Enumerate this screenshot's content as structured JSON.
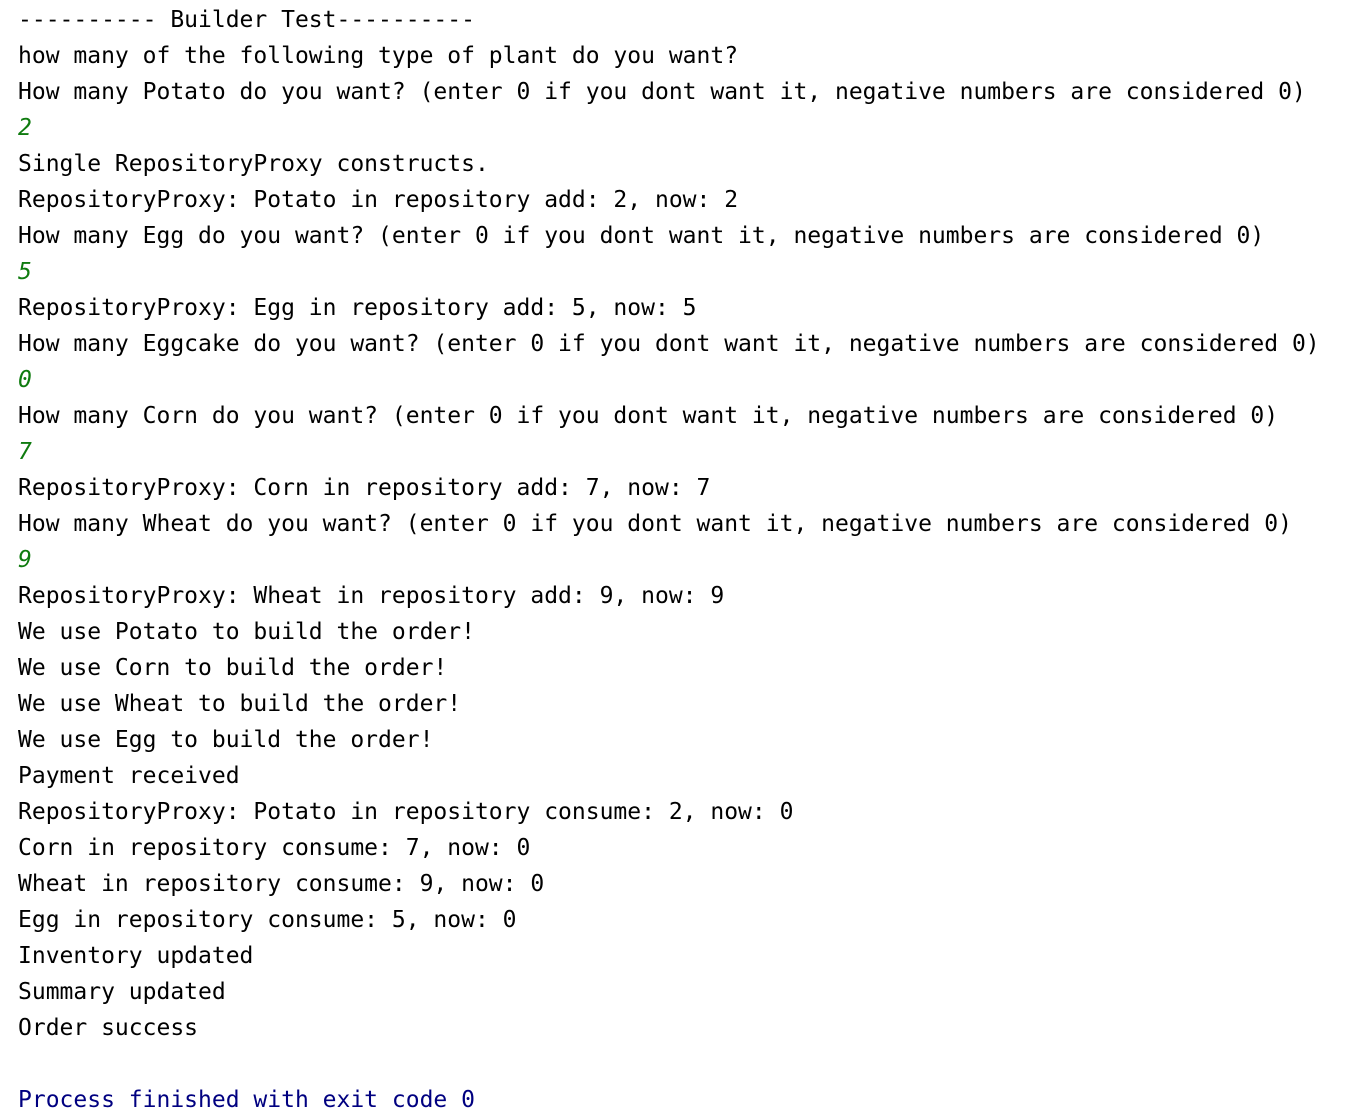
{
  "console": {
    "lines": [
      {
        "text": "---------- Builder Test----------",
        "kind": "output"
      },
      {
        "text": "how many of the following type of plant do you want?",
        "kind": "output"
      },
      {
        "text": "How many Potato do you want? (enter 0 if you dont want it, negative numbers are considered 0)",
        "kind": "output"
      },
      {
        "text": "2",
        "kind": "input"
      },
      {
        "text": "Single RepositoryProxy constructs.",
        "kind": "output"
      },
      {
        "text": "RepositoryProxy: Potato in repository add: 2, now: 2",
        "kind": "output"
      },
      {
        "text": "How many Egg do you want? (enter 0 if you dont want it, negative numbers are considered 0)",
        "kind": "output"
      },
      {
        "text": "5",
        "kind": "input"
      },
      {
        "text": "RepositoryProxy: Egg in repository add: 5, now: 5",
        "kind": "output"
      },
      {
        "text": "How many Eggcake do you want? (enter 0 if you dont want it, negative numbers are considered 0)",
        "kind": "output"
      },
      {
        "text": "0",
        "kind": "input"
      },
      {
        "text": "How many Corn do you want? (enter 0 if you dont want it, negative numbers are considered 0)",
        "kind": "output"
      },
      {
        "text": "7",
        "kind": "input"
      },
      {
        "text": "RepositoryProxy: Corn in repository add: 7, now: 7",
        "kind": "output"
      },
      {
        "text": "How many Wheat do you want? (enter 0 if you dont want it, negative numbers are considered 0)",
        "kind": "output"
      },
      {
        "text": "9",
        "kind": "input"
      },
      {
        "text": "RepositoryProxy: Wheat in repository add: 9, now: 9",
        "kind": "output"
      },
      {
        "text": "We use Potato to build the order!",
        "kind": "output"
      },
      {
        "text": "We use Corn to build the order!",
        "kind": "output"
      },
      {
        "text": "We use Wheat to build the order!",
        "kind": "output"
      },
      {
        "text": "We use Egg to build the order!",
        "kind": "output"
      },
      {
        "text": "Payment received",
        "kind": "output"
      },
      {
        "text": "RepositoryProxy: Potato in repository consume: 2, now: 0",
        "kind": "output"
      },
      {
        "text": "Corn in repository consume: 7, now: 0",
        "kind": "output"
      },
      {
        "text": "Wheat in repository consume: 9, now: 0",
        "kind": "output"
      },
      {
        "text": "Egg in repository consume: 5, now: 0",
        "kind": "output"
      },
      {
        "text": "Inventory updated",
        "kind": "output"
      },
      {
        "text": "Summary updated",
        "kind": "output"
      },
      {
        "text": "Order success",
        "kind": "output"
      },
      {
        "text": "",
        "kind": "blank"
      },
      {
        "text": "Process finished with exit code 0",
        "kind": "system"
      }
    ]
  },
  "colors": {
    "output_text": "#000000",
    "user_input": "#0f7b0f",
    "process_message": "#000080",
    "background": "#ffffff"
  }
}
